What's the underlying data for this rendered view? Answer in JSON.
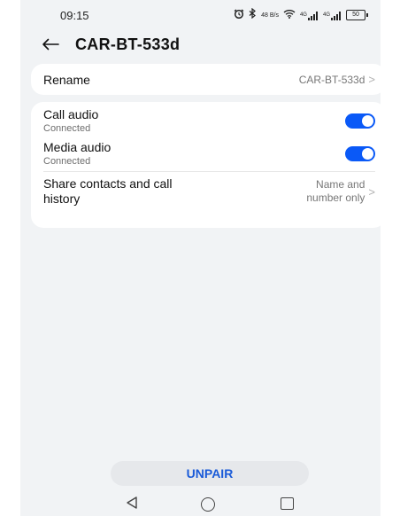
{
  "status_bar": {
    "time": "09:15",
    "icons": [
      "alarm-icon",
      "bluetooth-icon",
      "data-speed-icon",
      "wifi-icon",
      "signal-icon",
      "signal-icon",
      "battery-icon"
    ],
    "data_speed": "48 B/s",
    "signal1_label": "4G",
    "signal2_label": "4G",
    "battery_level": "50"
  },
  "header": {
    "title": "CAR-BT-533d"
  },
  "rename": {
    "label": "Rename",
    "value": "CAR-BT-533d"
  },
  "call_audio": {
    "label": "Call audio",
    "status": "Connected",
    "enabled": true
  },
  "media_audio": {
    "label": "Media audio",
    "status": "Connected",
    "enabled": true
  },
  "share_contacts": {
    "label_line1": "Share contacts and call",
    "label_line2": "history",
    "value_line1": "Name and",
    "value_line2": "number only"
  },
  "unpair_label": "UNPAIR",
  "colors": {
    "accent": "#0a59f7",
    "background": "#f1f3f5",
    "card": "#ffffff",
    "unpair_text": "#1a5bd8"
  }
}
